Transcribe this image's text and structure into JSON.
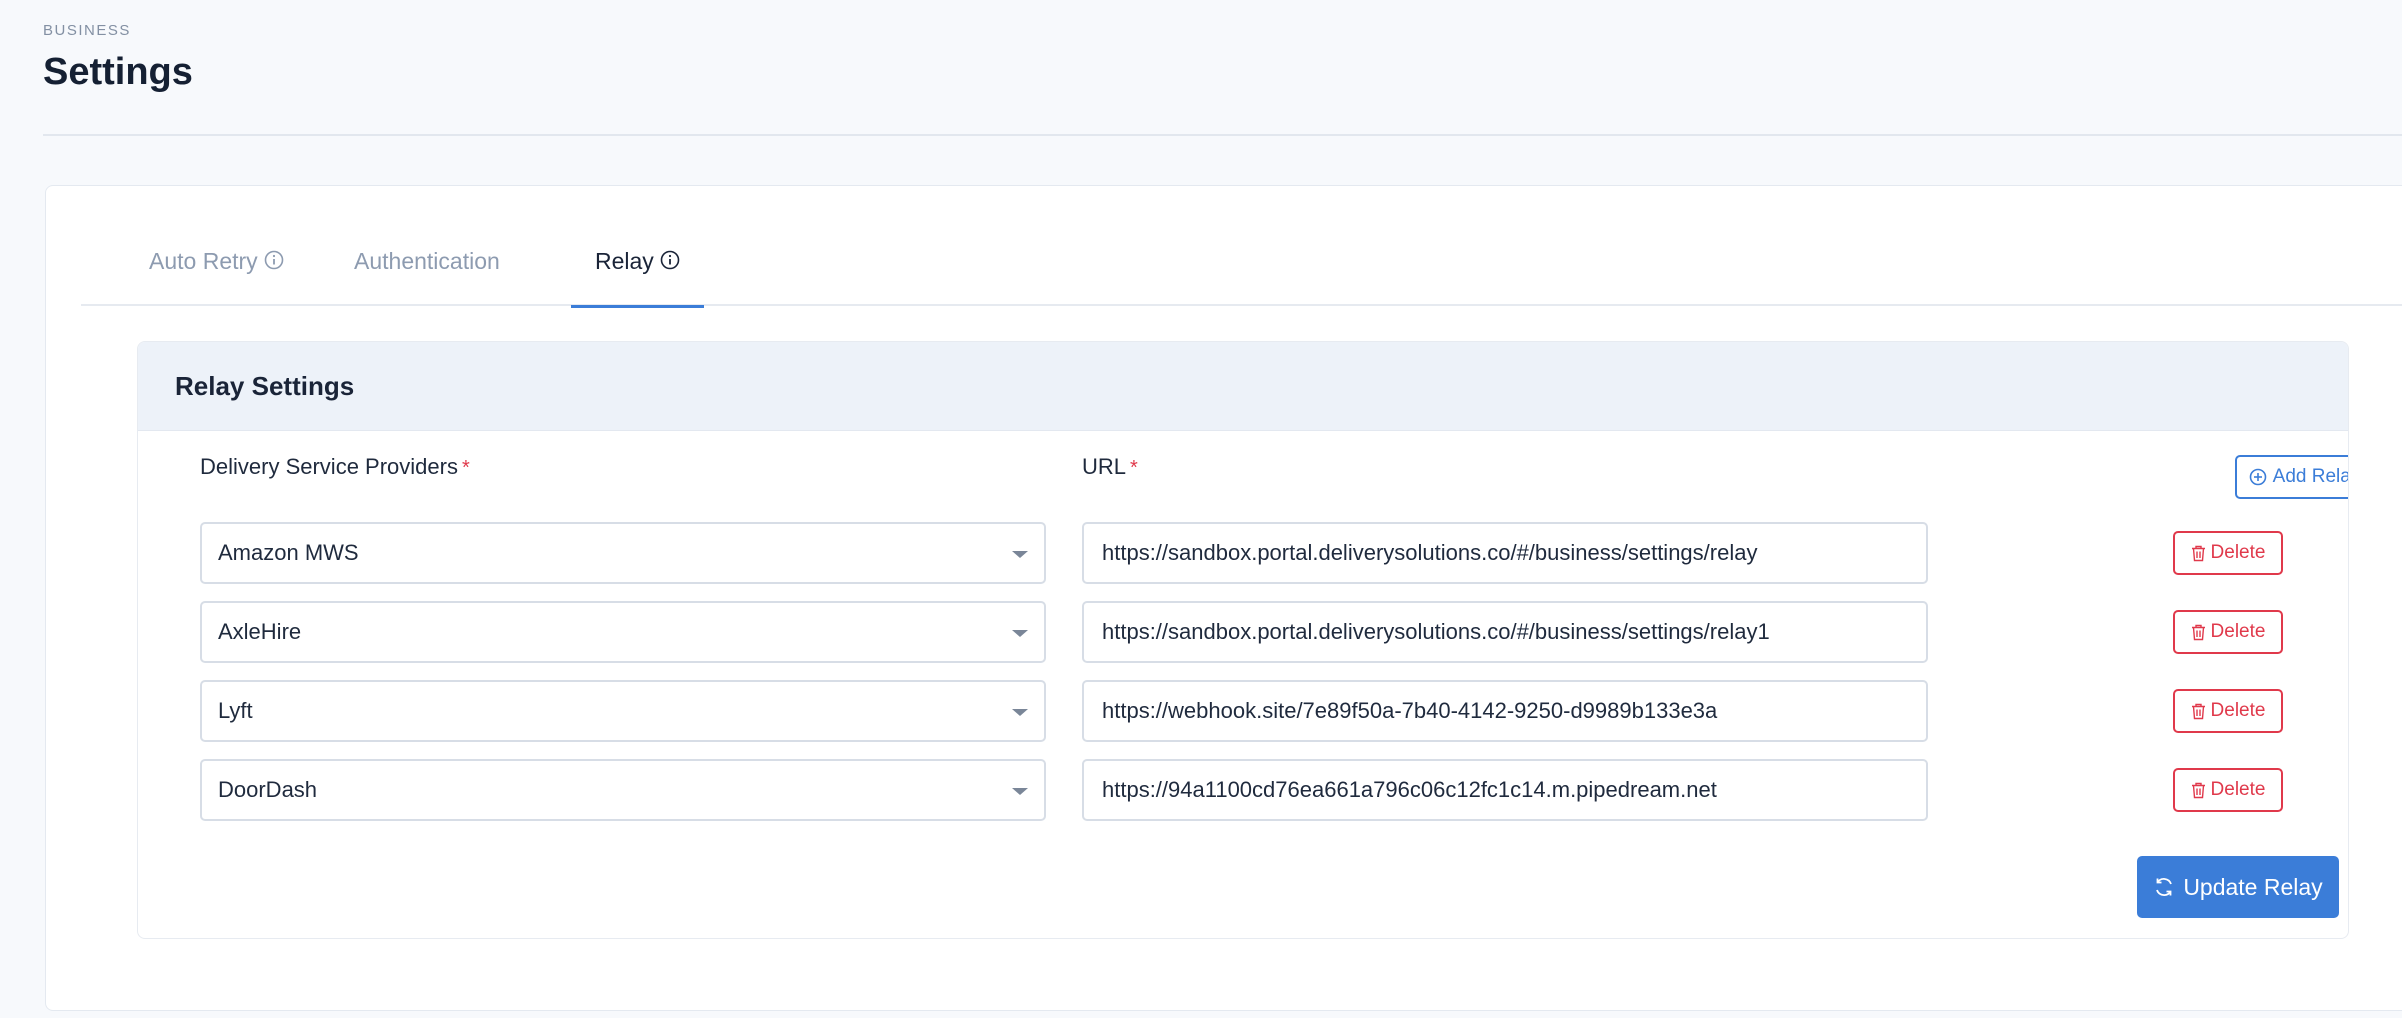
{
  "header": {
    "eyebrow": "BUSINESS",
    "title": "Settings"
  },
  "tabs": [
    {
      "label": "Auto Retry",
      "has_info": true,
      "active": false
    },
    {
      "label": "Authentication",
      "has_info": false,
      "active": false
    },
    {
      "label": "Relay",
      "has_info": true,
      "active": true
    }
  ],
  "panel": {
    "title": "Relay Settings",
    "providers_label": "Delivery Service Providers",
    "url_label": "URL",
    "required_mark": "*",
    "add_label": "Add Relay",
    "delete_label": "Delete",
    "update_label": "Update Relay",
    "rows": [
      {
        "provider": "Amazon MWS",
        "url": "https://sandbox.portal.deliverysolutions.co/#/business/settings/relay"
      },
      {
        "provider": "AxleHire",
        "url": "https://sandbox.portal.deliverysolutions.co/#/business/settings/relay1"
      },
      {
        "provider": "Lyft",
        "url": "https://webhook.site/7e89f50a-7b40-4142-9250-d9989b133e3a"
      },
      {
        "provider": "DoorDash",
        "url": "https://94a1100cd76ea661a796c06c12fc1c14.m.pipedream.net"
      }
    ]
  },
  "colors": {
    "accent": "#3b7dd8",
    "danger": "#e0394b",
    "panel_head": "#edf2f9"
  },
  "icons": [
    "info-icon",
    "plus-circle-icon",
    "trash-icon",
    "refresh-icon",
    "chevron-down-icon"
  ]
}
